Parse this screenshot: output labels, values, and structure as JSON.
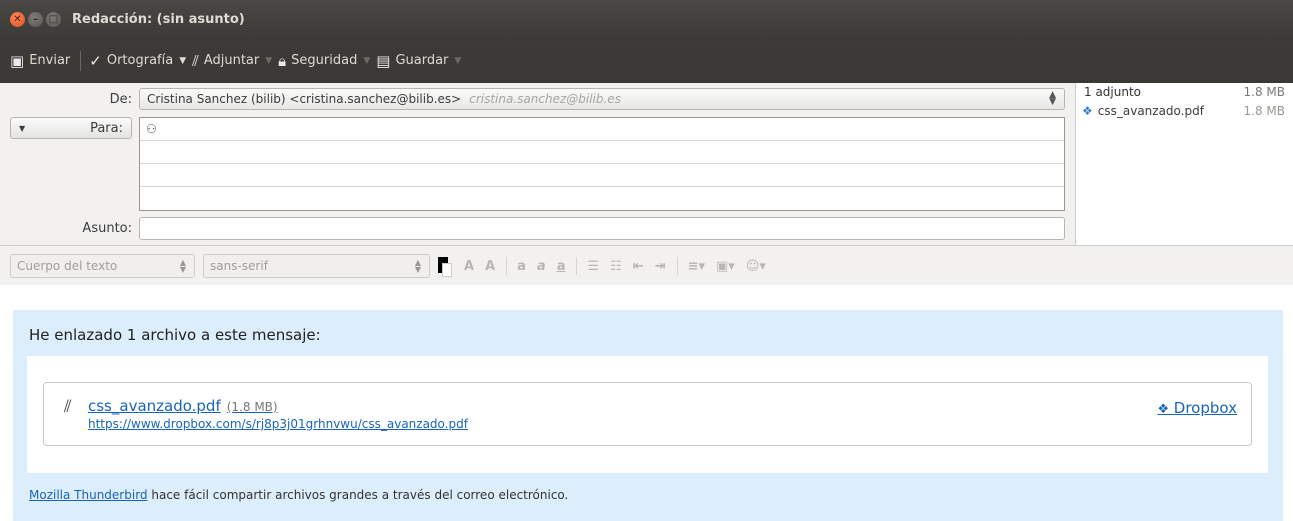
{
  "window": {
    "title": "Redacción: (sin asunto)"
  },
  "toolbar": {
    "send": "Enviar",
    "spelling": "Ortografía",
    "attach": "Adjuntar",
    "security": "Seguridad",
    "save": "Guardar"
  },
  "header": {
    "from_label": "De:",
    "from_value": "Cristina Sanchez (bilib) <cristina.sanchez@bilib.es>",
    "from_hint": "cristina.sanchez@bilib.es",
    "to_label": "Para:",
    "subject_label": "Asunto:",
    "subject_value": ""
  },
  "attachments": {
    "summary": "1 adjunto",
    "summary_size": "1.8 MB",
    "items": [
      {
        "name": "css_avanzado.pdf",
        "size": "1.8 MB"
      }
    ]
  },
  "format": {
    "paragraph_style": "Cuerpo del texto",
    "font": "sans-serif"
  },
  "message": {
    "heading": "He enlazado 1 archivo a este mensaje:",
    "file_name": "css_avanzado.pdf",
    "file_size": "(1.8 MB)",
    "file_url": "https://www.dropbox.com/s/rj8p3j01grhnvwu/css_avanzado.pdf",
    "provider": "Dropbox",
    "footer_link": "Mozilla Thunderbird",
    "footer_text": " hace fácil compartir archivos grandes a través del correo electrónico."
  }
}
